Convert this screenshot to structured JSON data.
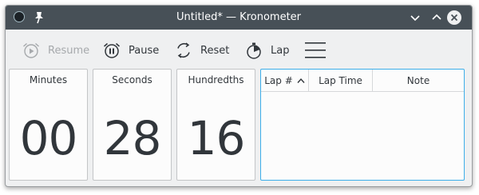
{
  "window": {
    "title": "Untitled* — Kronometer"
  },
  "toolbar": {
    "resume_label": "Resume",
    "pause_label": "Pause",
    "reset_label": "Reset",
    "lap_label": "Lap"
  },
  "display": [
    {
      "label": "Minutes",
      "value": "00"
    },
    {
      "label": "Seconds",
      "value": "28"
    },
    {
      "label": "Hundredths",
      "value": "16"
    }
  ],
  "laps_table": {
    "columns": [
      "Lap #",
      "Lap Time",
      "Note"
    ],
    "sort_column": "Lap #",
    "sort_direction": "ascending",
    "rows": []
  },
  "icons": {
    "app": "kronometer-app-icon",
    "pin": "pin-icon",
    "minimize": "chevron-down-icon",
    "maximize": "chevron-up-icon",
    "close": "close-icon",
    "resume": "play-circle-icon",
    "pause": "pause-circle-icon",
    "reset": "circular-arrows-icon",
    "lap": "stopwatch-icon",
    "menu": "hamburger-menu-icon",
    "sort": "chevron-up-icon"
  },
  "colors": {
    "titlebar": "#475057",
    "window_bg": "#eff0f1",
    "text": "#31363b",
    "disabled_text": "#a6a9ac",
    "focus_accent": "#3daee9"
  }
}
